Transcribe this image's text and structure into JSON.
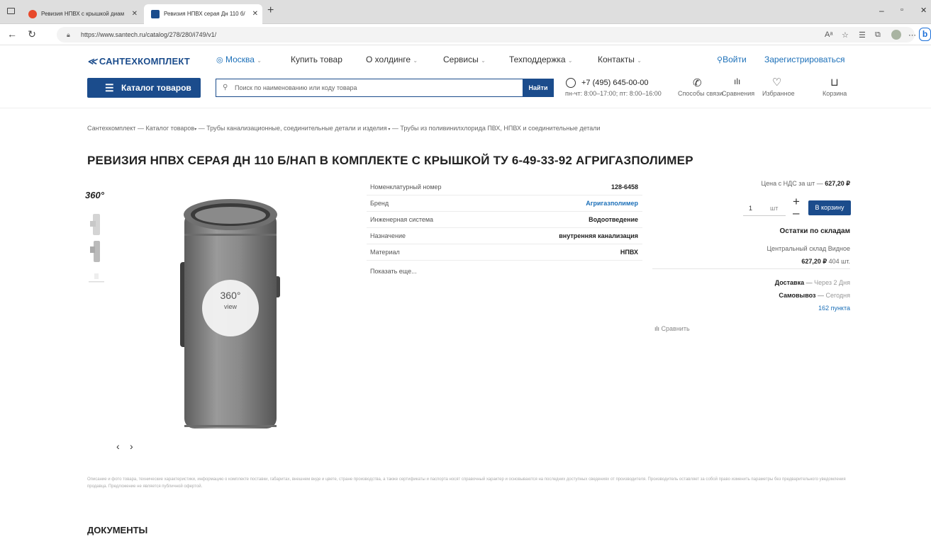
{
  "browser": {
    "tabs": [
      {
        "title": "Ревизия НПВХ с крышкой диам"
      },
      {
        "title": "Ревизия НПВХ серая Дн 110 б/"
      }
    ],
    "url": "https://www.santech.ru/catalog/278/280/i749/v1/"
  },
  "site": {
    "logo": "САНТЕХКОМПЛЕКТ",
    "city": "Москва",
    "nav": [
      "Купить товар",
      "О холдинге",
      "Сервисы",
      "Техподдержка",
      "Контакты"
    ],
    "login": "Войти",
    "register": "Зарегистрироваться",
    "catalog_button": "Каталог товаров",
    "search_placeholder": "Поиск по наименованию или коду товара",
    "search_button": "Найти",
    "phone": "+7 (495) 645-00-00",
    "hours": "пн-чт: 8:00–17:00; пт: 8:00–16:00",
    "icons": [
      {
        "label": "Способы связи",
        "icon": "phone-icon"
      },
      {
        "label": "Сравнения",
        "icon": "compare-icon"
      },
      {
        "label": "Избранное",
        "icon": "heart-icon"
      },
      {
        "label": "Корзина",
        "icon": "cart-icon"
      }
    ]
  },
  "breadcrumb": {
    "items": [
      "Сантехкомплект",
      "Каталог товаров",
      "Трубы канализационные, соединительные детали и изделия",
      "Трубы из поливинилхлорида ПВХ, НПВХ и соединительные детали"
    ]
  },
  "product": {
    "title": "РЕВИЗИЯ НПВХ СЕРАЯ ДН 110 Б/НАП В КОМПЛЕКТЕ С КРЫШКОЙ ТУ 6-49-33-92 АГРИГАЗПОЛИМЕР",
    "badge_360": "360°",
    "view_360_label": "360°",
    "view_360_sub": "view",
    "specs": [
      {
        "key": "Номенклатурный номер",
        "value": "128-6458"
      },
      {
        "key": "Бренд",
        "value": "Агригазполимер"
      },
      {
        "key": "Инженерная система",
        "value": "Водоотведение"
      },
      {
        "key": "Назначение",
        "value": "внутренняя канализация"
      },
      {
        "key": "Материал",
        "value": "НПВХ"
      }
    ],
    "show_more": "Показать еще...",
    "compare": "Сравнить"
  },
  "buy": {
    "price_label": "Цена с НДС за шт —",
    "price": "627,20 ₽",
    "qty": "1",
    "unit": "шт",
    "cart_button": "В корзину",
    "stock_title": "Остатки по складам",
    "warehouse": "Центральный склад Видное",
    "warehouse_price": "627,20 ₽",
    "warehouse_qty": "404 шт.",
    "delivery_label": "Доставка",
    "delivery_value": "Через 2 Дня",
    "pickup_label": "Самовывоз",
    "pickup_value": "Сегодня",
    "points": "162 пункта"
  },
  "disclaimer": "Описание и фото товара, технические характеристики, информацию о комплекте поставки, габаритах, внешнем виде и цвете, стране производства, а также сертификаты и паспорта носят справочный характер и основываются на последних доступных сведениях от производителя. Производитель оставляет за собой право изменить параметры без предварительного уведомления продавца. Предложение не является публичной офертой.",
  "documents_title": "ДОКУМЕНТЫ"
}
